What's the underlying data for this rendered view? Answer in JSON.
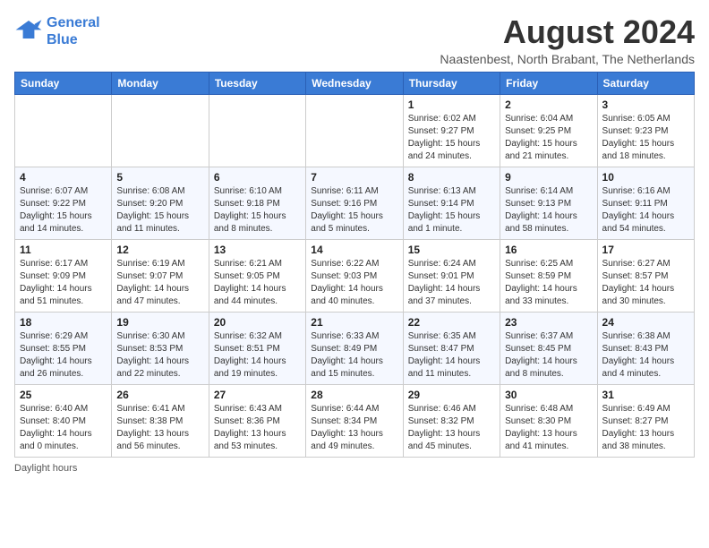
{
  "logo": {
    "line1": "General",
    "line2": "Blue"
  },
  "title": "August 2024",
  "subtitle": "Naastenbest, North Brabant, The Netherlands",
  "days_of_week": [
    "Sunday",
    "Monday",
    "Tuesday",
    "Wednesday",
    "Thursday",
    "Friday",
    "Saturday"
  ],
  "weeks": [
    [
      {
        "day": "",
        "info": ""
      },
      {
        "day": "",
        "info": ""
      },
      {
        "day": "",
        "info": ""
      },
      {
        "day": "",
        "info": ""
      },
      {
        "day": "1",
        "info": "Sunrise: 6:02 AM\nSunset: 9:27 PM\nDaylight: 15 hours\nand 24 minutes."
      },
      {
        "day": "2",
        "info": "Sunrise: 6:04 AM\nSunset: 9:25 PM\nDaylight: 15 hours\nand 21 minutes."
      },
      {
        "day": "3",
        "info": "Sunrise: 6:05 AM\nSunset: 9:23 PM\nDaylight: 15 hours\nand 18 minutes."
      }
    ],
    [
      {
        "day": "4",
        "info": "Sunrise: 6:07 AM\nSunset: 9:22 PM\nDaylight: 15 hours\nand 14 minutes."
      },
      {
        "day": "5",
        "info": "Sunrise: 6:08 AM\nSunset: 9:20 PM\nDaylight: 15 hours\nand 11 minutes."
      },
      {
        "day": "6",
        "info": "Sunrise: 6:10 AM\nSunset: 9:18 PM\nDaylight: 15 hours\nand 8 minutes."
      },
      {
        "day": "7",
        "info": "Sunrise: 6:11 AM\nSunset: 9:16 PM\nDaylight: 15 hours\nand 5 minutes."
      },
      {
        "day": "8",
        "info": "Sunrise: 6:13 AM\nSunset: 9:14 PM\nDaylight: 15 hours\nand 1 minute."
      },
      {
        "day": "9",
        "info": "Sunrise: 6:14 AM\nSunset: 9:13 PM\nDaylight: 14 hours\nand 58 minutes."
      },
      {
        "day": "10",
        "info": "Sunrise: 6:16 AM\nSunset: 9:11 PM\nDaylight: 14 hours\nand 54 minutes."
      }
    ],
    [
      {
        "day": "11",
        "info": "Sunrise: 6:17 AM\nSunset: 9:09 PM\nDaylight: 14 hours\nand 51 minutes."
      },
      {
        "day": "12",
        "info": "Sunrise: 6:19 AM\nSunset: 9:07 PM\nDaylight: 14 hours\nand 47 minutes."
      },
      {
        "day": "13",
        "info": "Sunrise: 6:21 AM\nSunset: 9:05 PM\nDaylight: 14 hours\nand 44 minutes."
      },
      {
        "day": "14",
        "info": "Sunrise: 6:22 AM\nSunset: 9:03 PM\nDaylight: 14 hours\nand 40 minutes."
      },
      {
        "day": "15",
        "info": "Sunrise: 6:24 AM\nSunset: 9:01 PM\nDaylight: 14 hours\nand 37 minutes."
      },
      {
        "day": "16",
        "info": "Sunrise: 6:25 AM\nSunset: 8:59 PM\nDaylight: 14 hours\nand 33 minutes."
      },
      {
        "day": "17",
        "info": "Sunrise: 6:27 AM\nSunset: 8:57 PM\nDaylight: 14 hours\nand 30 minutes."
      }
    ],
    [
      {
        "day": "18",
        "info": "Sunrise: 6:29 AM\nSunset: 8:55 PM\nDaylight: 14 hours\nand 26 minutes."
      },
      {
        "day": "19",
        "info": "Sunrise: 6:30 AM\nSunset: 8:53 PM\nDaylight: 14 hours\nand 22 minutes."
      },
      {
        "day": "20",
        "info": "Sunrise: 6:32 AM\nSunset: 8:51 PM\nDaylight: 14 hours\nand 19 minutes."
      },
      {
        "day": "21",
        "info": "Sunrise: 6:33 AM\nSunset: 8:49 PM\nDaylight: 14 hours\nand 15 minutes."
      },
      {
        "day": "22",
        "info": "Sunrise: 6:35 AM\nSunset: 8:47 PM\nDaylight: 14 hours\nand 11 minutes."
      },
      {
        "day": "23",
        "info": "Sunrise: 6:37 AM\nSunset: 8:45 PM\nDaylight: 14 hours\nand 8 minutes."
      },
      {
        "day": "24",
        "info": "Sunrise: 6:38 AM\nSunset: 8:43 PM\nDaylight: 14 hours\nand 4 minutes."
      }
    ],
    [
      {
        "day": "25",
        "info": "Sunrise: 6:40 AM\nSunset: 8:40 PM\nDaylight: 14 hours\nand 0 minutes."
      },
      {
        "day": "26",
        "info": "Sunrise: 6:41 AM\nSunset: 8:38 PM\nDaylight: 13 hours\nand 56 minutes."
      },
      {
        "day": "27",
        "info": "Sunrise: 6:43 AM\nSunset: 8:36 PM\nDaylight: 13 hours\nand 53 minutes."
      },
      {
        "day": "28",
        "info": "Sunrise: 6:44 AM\nSunset: 8:34 PM\nDaylight: 13 hours\nand 49 minutes."
      },
      {
        "day": "29",
        "info": "Sunrise: 6:46 AM\nSunset: 8:32 PM\nDaylight: 13 hours\nand 45 minutes."
      },
      {
        "day": "30",
        "info": "Sunrise: 6:48 AM\nSunset: 8:30 PM\nDaylight: 13 hours\nand 41 minutes."
      },
      {
        "day": "31",
        "info": "Sunrise: 6:49 AM\nSunset: 8:27 PM\nDaylight: 13 hours\nand 38 minutes."
      }
    ]
  ],
  "footer": "Daylight hours"
}
